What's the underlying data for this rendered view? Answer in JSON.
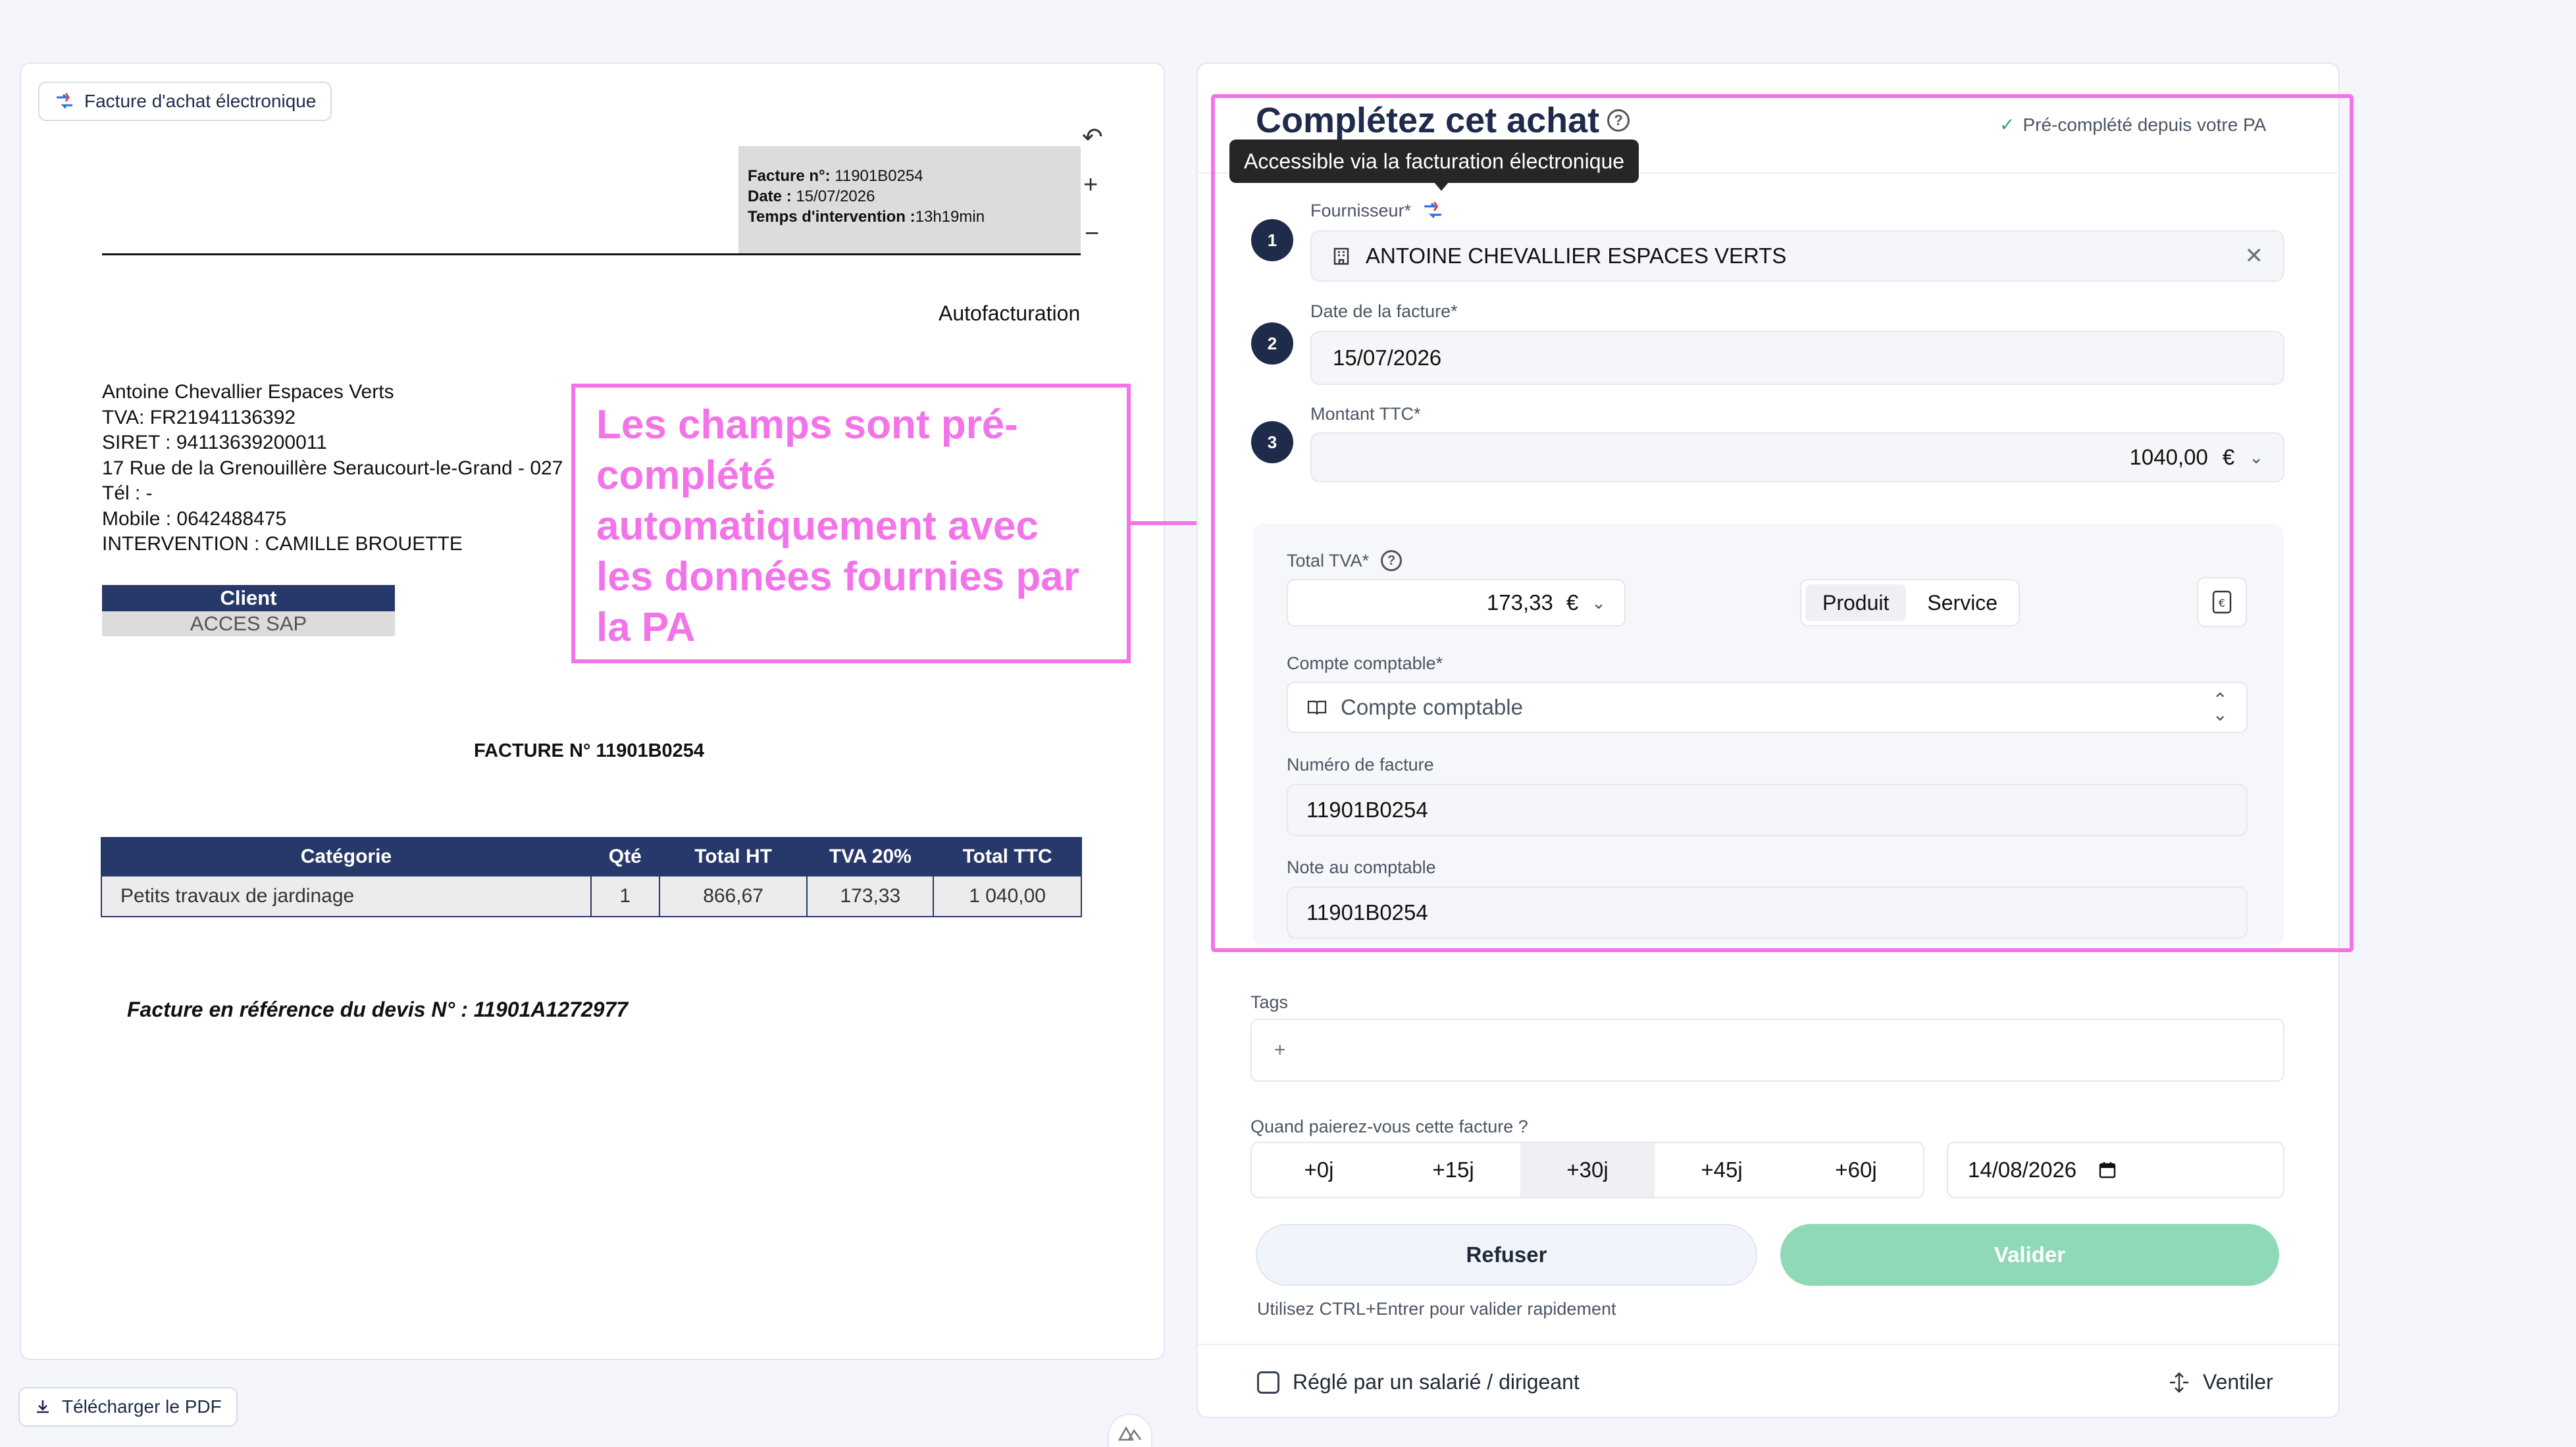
{
  "pdf_viewer": {
    "badge_label": "Facture d'achat électronique",
    "download_label": "Télécharger le PDF"
  },
  "invoice": {
    "header": {
      "facture_label": "Facture n°:",
      "facture_value": "11901B0254",
      "date_label": "Date :",
      "date_value": "15/07/2026",
      "temps_label": "Temps d'intervention :",
      "temps_value": "13h19min"
    },
    "autofacturation": "Autofacturation",
    "supplier_lines": [
      "Antoine Chevallier Espaces Verts",
      "TVA: FR21941136392",
      "SIRET : 94113639200011",
      "17 Rue de la Grenouillère Seraucourt-le-Grand - 027",
      "Tél : -",
      "Mobile : 0642488475",
      "INTERVENTION : CAMILLE BROUETTE"
    ],
    "client_label": "Client",
    "client_value": "ACCES SAP",
    "facture_title": "FACTURE N° 11901B0254",
    "table": {
      "headers": [
        "Catégorie",
        "Qté",
        "Total HT",
        "TVA 20%",
        "Total TTC"
      ],
      "rows": [
        [
          "Petits travaux de jardinage",
          "1",
          "866,67",
          "173,33",
          "1 040,00"
        ]
      ]
    },
    "reference": "Facture en référence du devis N° : 11901A1272977"
  },
  "annotation": {
    "text": "Les champs sont pré-complété automatiquement avec les données fournies par la PA",
    "color": "#f274e8"
  },
  "form": {
    "title": "Complétez cet achat",
    "prefilled": "Pré-complété depuis votre PA",
    "tooltip": "Accessible via la facturation électronique",
    "supplier": {
      "step": "1",
      "label": "Fournisseur*",
      "value": "ANTOINE CHEVALLIER ESPACES VERTS"
    },
    "date": {
      "step": "2",
      "label": "Date de la facture*",
      "value": "15/07/2026"
    },
    "amount": {
      "step": "3",
      "label": "Montant TTC*",
      "value": "1040,00",
      "currency": "€"
    },
    "tva": {
      "label": "Total TVA*",
      "value": "173,33",
      "currency": "€"
    },
    "type_options": [
      "Produit",
      "Service"
    ],
    "type_selected": "Produit",
    "account": {
      "label": "Compte comptable*",
      "placeholder": "Compte comptable"
    },
    "invoice_number": {
      "label": "Numéro de facture",
      "value": "11901B0254"
    },
    "note": {
      "label": "Note au comptable",
      "value": "11901B0254"
    },
    "tags": {
      "label": "Tags",
      "placeholder": "+"
    },
    "payment": {
      "label": "Quand paierez-vous cette facture ?",
      "options": [
        "+0j",
        "+15j",
        "+30j",
        "+45j",
        "+60j"
      ],
      "selected": "+30j",
      "date": "14/08/2026"
    },
    "refuse_label": "Refuser",
    "validate_label": "Valider",
    "hint": "Utilisez CTRL+Entrer pour valider rapidement",
    "paid_by_label": "Réglé par un salarié / dirigeant",
    "ventiler_label": "Ventiler"
  },
  "colors": {
    "navy": "#1e2b4a",
    "table_header": "#27386a",
    "validate_green": "#8fd9b6",
    "annotation_pink": "#f274e8"
  }
}
